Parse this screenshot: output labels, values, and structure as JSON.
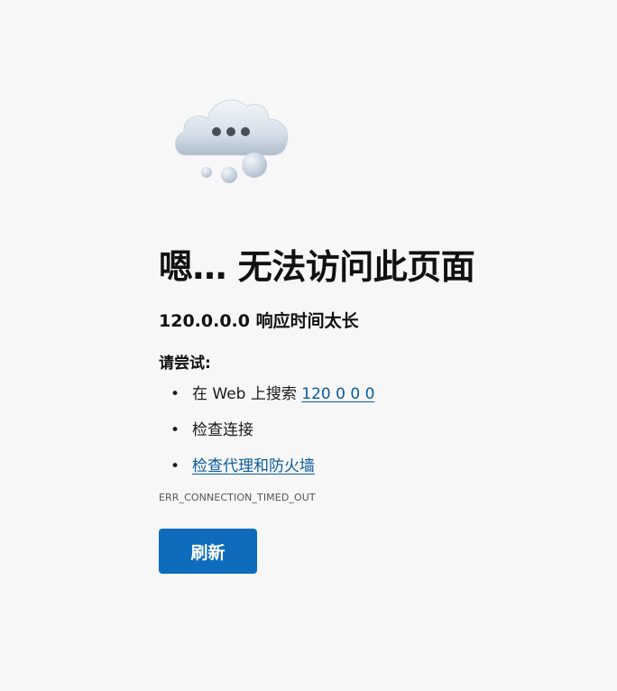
{
  "error": {
    "title": "嗯… 无法访问此页面",
    "subtitle": "120.0.0.0 响应时间太长",
    "try_heading": "请尝试:",
    "suggestions": [
      {
        "prefix": "在 Web 上搜索 ",
        "link": "120 0 0 0"
      },
      {
        "text": "检查连接"
      },
      {
        "link": "检查代理和防火墙"
      }
    ],
    "code": "ERR_CONNECTION_TIMED_OUT",
    "refresh_label": "刷新"
  },
  "illustration": "cloud-with-dots-icon",
  "colors": {
    "background": "#f7f7f7",
    "button": "#0f6cbd",
    "link": "#0a5b9c"
  }
}
